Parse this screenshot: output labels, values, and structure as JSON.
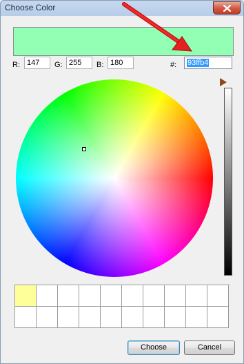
{
  "window": {
    "title": "Choose Color"
  },
  "preview": {
    "color": "#93ffb4"
  },
  "fields": {
    "r_label": "R:",
    "r_value": "147",
    "g_label": "G:",
    "g_value": "255",
    "b_label": "B:",
    "b_value": "180",
    "hex_label": "#:",
    "hex_value": "93ffb4"
  },
  "swatches": [
    "#ffff99",
    "#ffffff",
    "#ffffff",
    "#ffffff",
    "#ffffff",
    "#ffffff",
    "#ffffff",
    "#ffffff",
    "#ffffff",
    "#ffffff",
    "#ffffff",
    "#ffffff",
    "#ffffff",
    "#ffffff",
    "#ffffff",
    "#ffffff",
    "#ffffff",
    "#ffffff",
    "#ffffff",
    "#ffffff"
  ],
  "buttons": {
    "choose": "Choose",
    "cancel": "Cancel"
  },
  "colors": {
    "accent_arrow": "#e02020",
    "selection": "#3399ff"
  },
  "icons": {
    "close": "close-icon",
    "annotation": "red-arrow-annotation"
  }
}
